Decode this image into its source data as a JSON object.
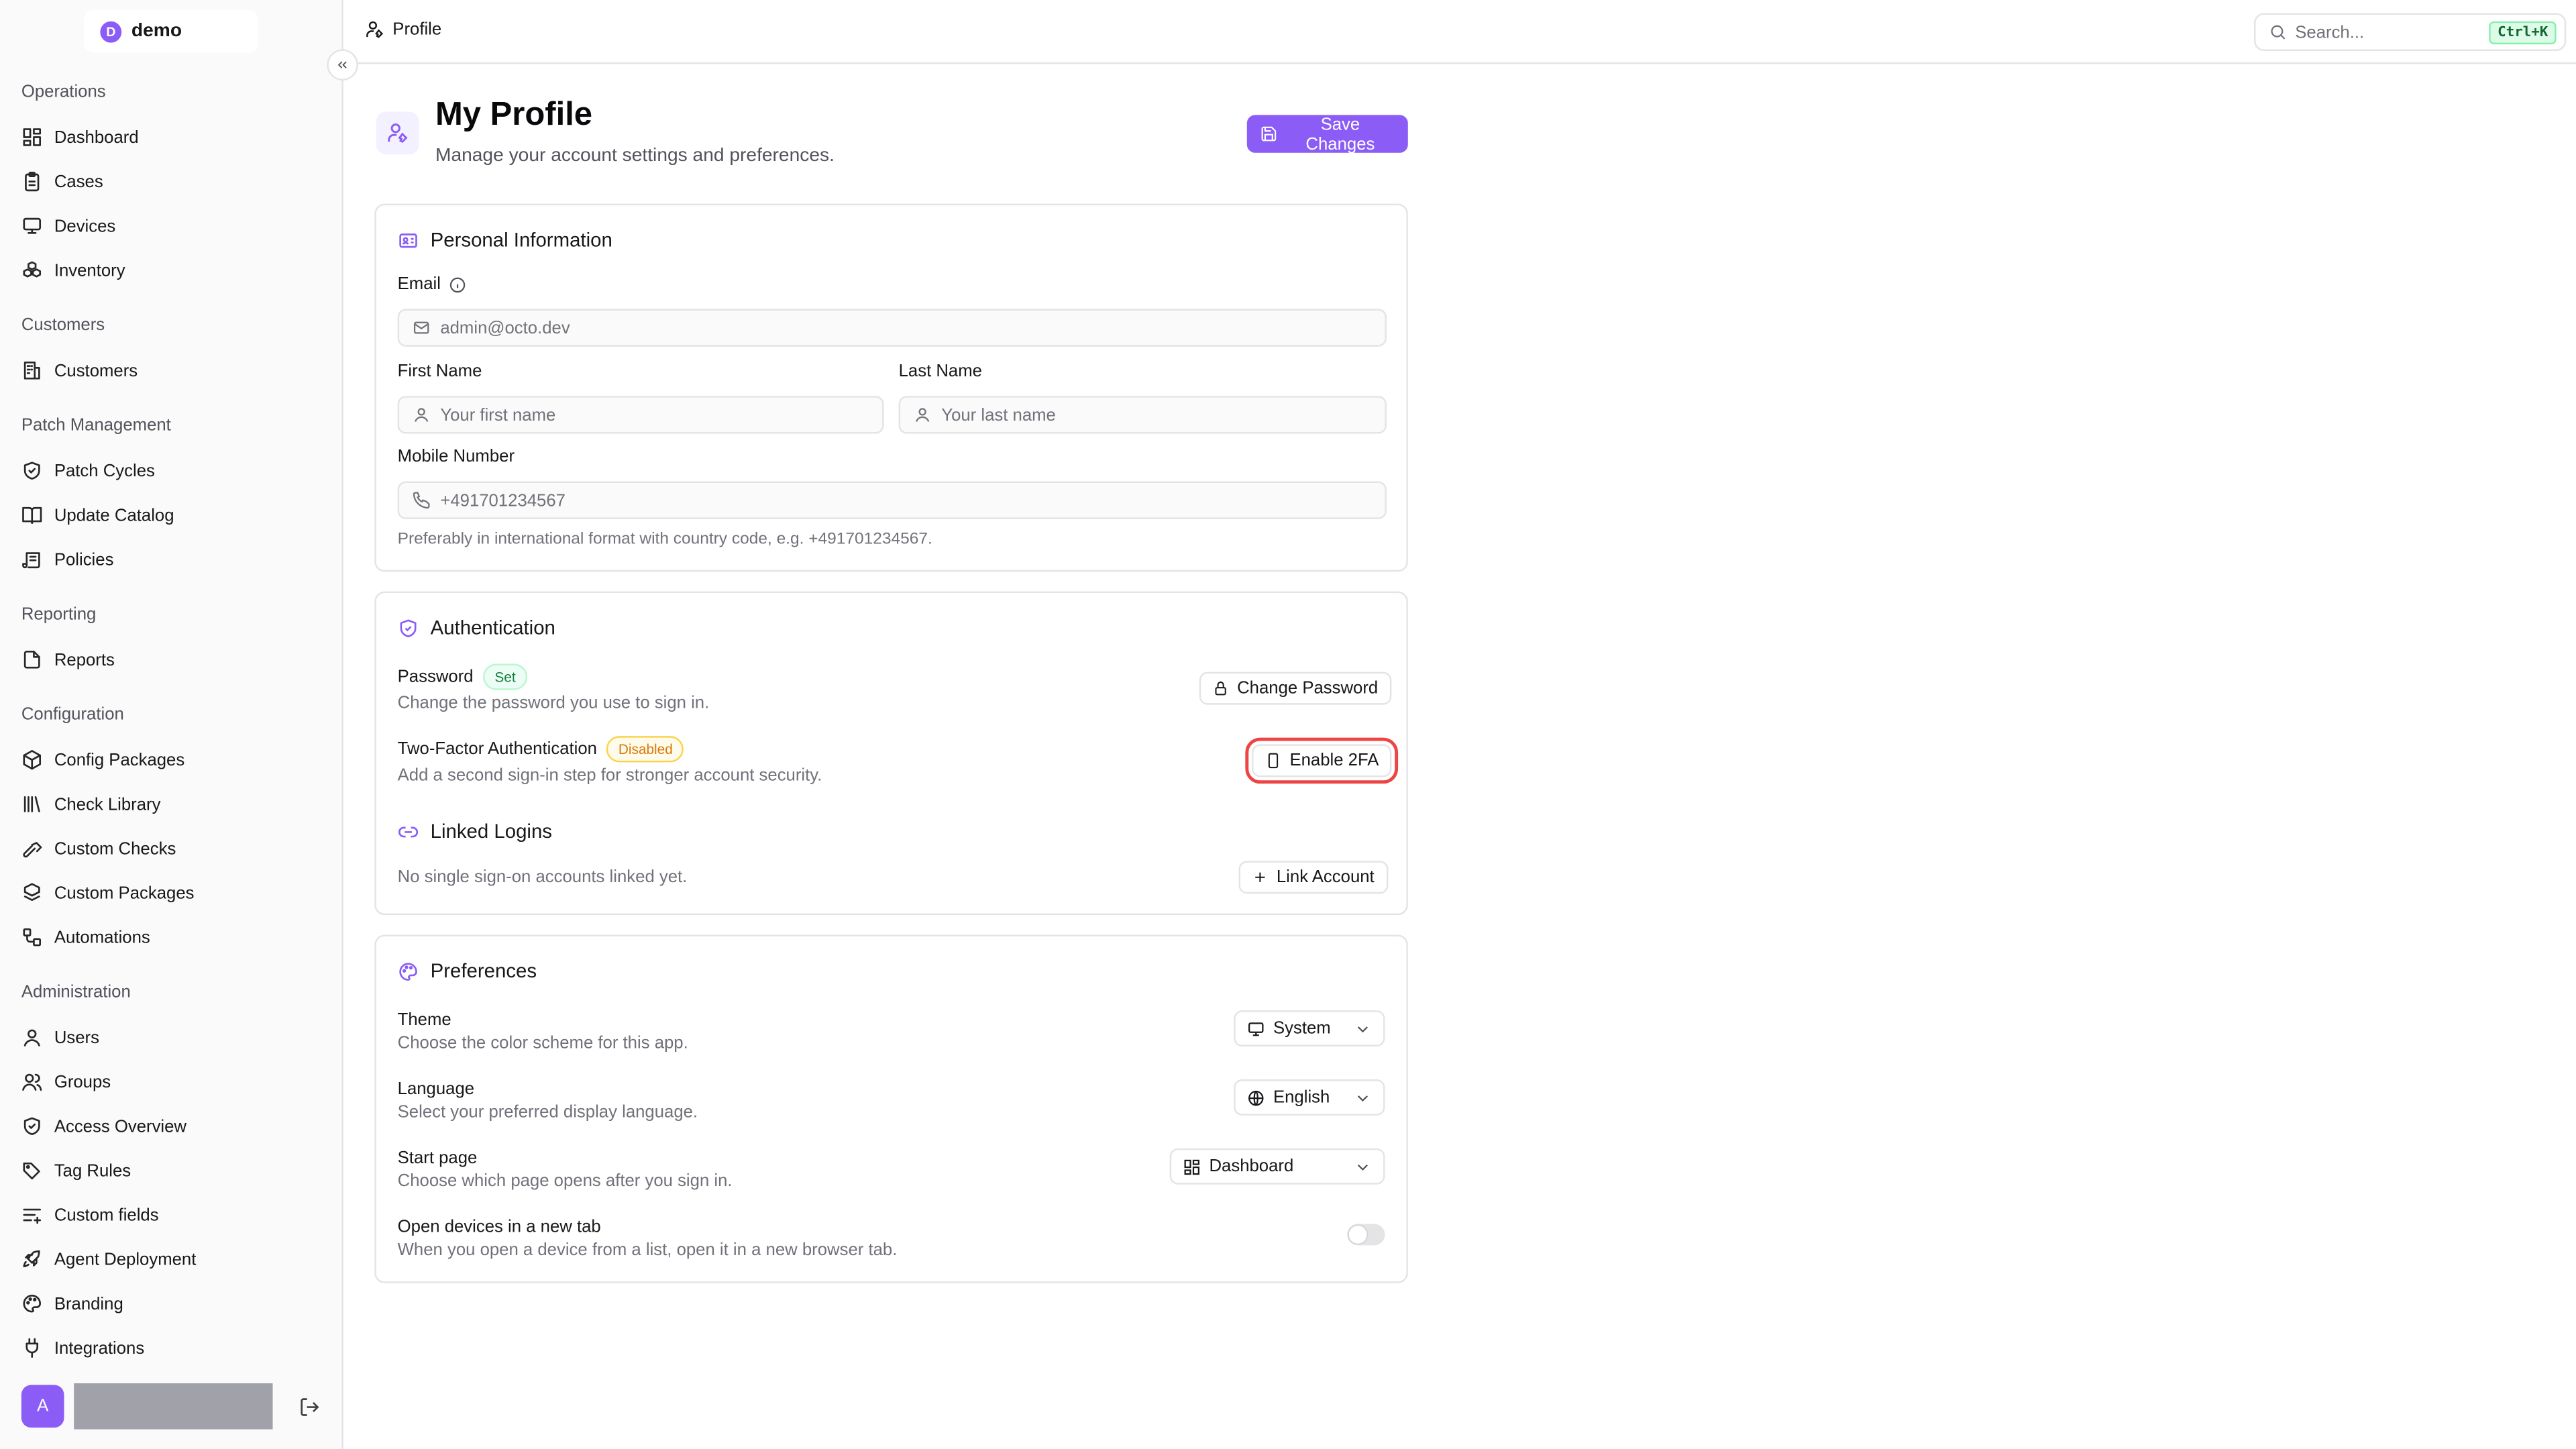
{
  "app": {
    "brand_initial": "D",
    "brand_name": "demo"
  },
  "topbar": {
    "breadcrumb": "Profile",
    "search_placeholder": "Search...",
    "search_shortcut": "Ctrl+K"
  },
  "sidebar": {
    "sections": [
      {
        "title": "Operations",
        "items": [
          {
            "label": "Dashboard",
            "icon": "dashboard-icon"
          },
          {
            "label": "Cases",
            "icon": "clipboard-icon"
          },
          {
            "label": "Devices",
            "icon": "monitor-icon"
          },
          {
            "label": "Inventory",
            "icon": "boxes-icon"
          }
        ]
      },
      {
        "title": "Customers",
        "items": [
          {
            "label": "Customers",
            "icon": "building-icon"
          }
        ]
      },
      {
        "title": "Patch Management",
        "items": [
          {
            "label": "Patch Cycles",
            "icon": "shield-icon"
          },
          {
            "label": "Update Catalog",
            "icon": "book-icon"
          },
          {
            "label": "Policies",
            "icon": "scroll-icon"
          }
        ]
      },
      {
        "title": "Reporting",
        "items": [
          {
            "label": "Reports",
            "icon": "file-icon"
          }
        ]
      },
      {
        "title": "Configuration",
        "items": [
          {
            "label": "Config Packages",
            "icon": "package-icon"
          },
          {
            "label": "Check Library",
            "icon": "library-icon"
          },
          {
            "label": "Custom Checks",
            "icon": "hammer-icon"
          },
          {
            "label": "Custom Packages",
            "icon": "packages-icon"
          },
          {
            "label": "Automations",
            "icon": "workflow-icon"
          }
        ]
      },
      {
        "title": "Administration",
        "items": [
          {
            "label": "Users",
            "icon": "user-icon"
          },
          {
            "label": "Groups",
            "icon": "users-icon"
          },
          {
            "label": "Access Overview",
            "icon": "shield-check-icon"
          },
          {
            "label": "Tag Rules",
            "icon": "tags-icon"
          },
          {
            "label": "Custom fields",
            "icon": "list-icon"
          },
          {
            "label": "Agent Deployment",
            "icon": "rocket-icon"
          },
          {
            "label": "Branding",
            "icon": "palette-icon"
          },
          {
            "label": "Integrations",
            "icon": "plug-icon"
          }
        ]
      }
    ],
    "user_initial": "A"
  },
  "page": {
    "title": "My Profile",
    "subtitle": "Manage your account settings and preferences.",
    "save_label": "Save Changes"
  },
  "personal": {
    "title": "Personal Information",
    "email_label": "Email",
    "email_value": "admin@octo.dev",
    "first_name_label": "First Name",
    "first_name_placeholder": "Your first name",
    "last_name_label": "Last Name",
    "last_name_placeholder": "Your last name",
    "mobile_label": "Mobile Number",
    "mobile_placeholder": "+491701234567",
    "mobile_hint": "Preferably in international format with country code, e.g. +491701234567."
  },
  "auth": {
    "title": "Authentication",
    "password_label": "Password",
    "password_badge": "Set",
    "password_desc": "Change the password you use to sign in.",
    "change_password_label": "Change Password",
    "tfa_label": "Two-Factor Authentication",
    "tfa_badge": "Disabled",
    "tfa_desc": "Add a second sign-in step for stronger account security.",
    "enable_2fa_label": "Enable 2FA",
    "linked_title": "Linked Logins",
    "linked_desc": "No single sign-on accounts linked yet.",
    "link_account_label": "Link Account"
  },
  "prefs": {
    "title": "Preferences",
    "theme_label": "Theme",
    "theme_desc": "Choose the color scheme for this app.",
    "theme_value": "System",
    "language_label": "Language",
    "language_desc": "Select your preferred display language.",
    "language_value": "English",
    "start_label": "Start page",
    "start_desc": "Choose which page opens after you sign in.",
    "start_value": "Dashboard",
    "newtab_label": "Open devices in a new tab",
    "newtab_desc": "When you open a device from a list, open it in a new browser tab.",
    "newtab_enabled": false
  }
}
